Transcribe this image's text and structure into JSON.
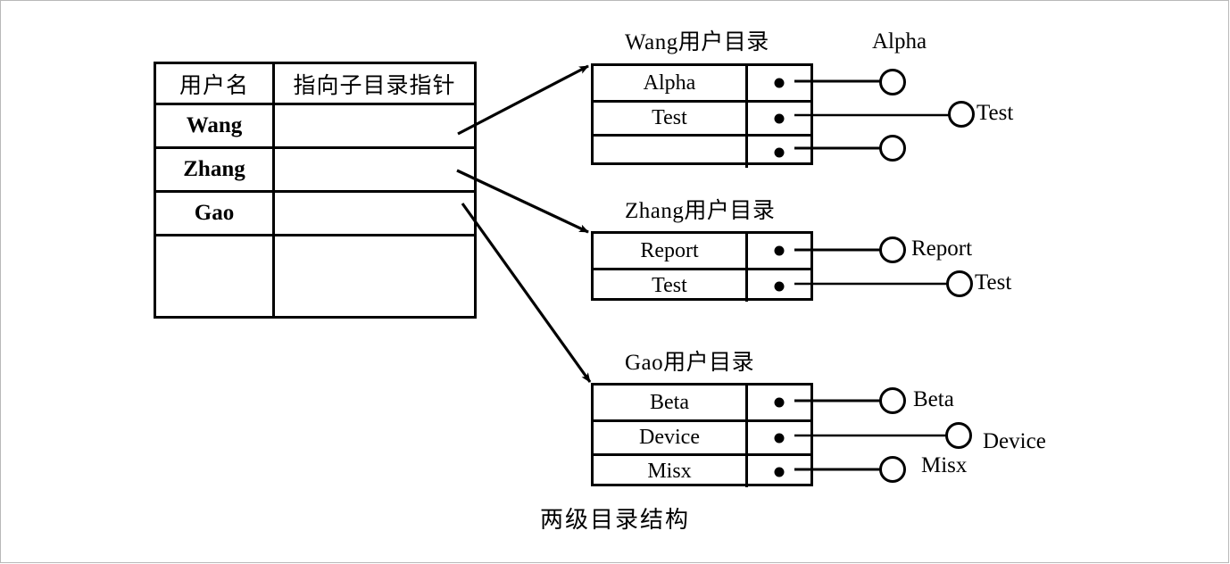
{
  "caption": "两级目录结构",
  "master_table": {
    "name": "user-master-table",
    "headers": [
      "用户名",
      "指向子目录指针"
    ],
    "rows": [
      {
        "user": "Wang",
        "pointer": ""
      },
      {
        "user": "Zhang",
        "pointer": ""
      },
      {
        "user": "Gao",
        "pointer": ""
      },
      {
        "user": "",
        "pointer": ""
      }
    ]
  },
  "directories": [
    {
      "id": "wang",
      "title": "Wang用户目录",
      "entries": [
        {
          "name": "Alpha",
          "pointer_dot": "●",
          "leaf": "Alpha"
        },
        {
          "name": "Test",
          "pointer_dot": "●",
          "leaf": "Test"
        },
        {
          "name": "",
          "pointer_dot": "●",
          "leaf": ""
        }
      ]
    },
    {
      "id": "zhang",
      "title": "Zhang用户目录",
      "entries": [
        {
          "name": "Report",
          "pointer_dot": "●",
          "leaf": "Report"
        },
        {
          "name": "Test",
          "pointer_dot": "●",
          "leaf": "Test"
        }
      ]
    },
    {
      "id": "gao",
      "title": "Gao用户目录",
      "entries": [
        {
          "name": "Beta",
          "pointer_dot": "●",
          "leaf": "Beta"
        },
        {
          "name": "Device",
          "pointer_dot": "●",
          "leaf": "Device"
        },
        {
          "name": "Misx",
          "pointer_dot": "●",
          "leaf": "Misx"
        }
      ]
    }
  ],
  "leaf_labels": {
    "wang_alpha": "Alpha",
    "wang_test": "Test",
    "zhang_report": "Report",
    "zhang_test": "Test",
    "gao_beta": "Beta",
    "gao_device": "Device",
    "gao_misx": "Misx"
  },
  "colors": {
    "ink": "#000000",
    "paper": "#ffffff",
    "frame": "#b9b9b9"
  }
}
